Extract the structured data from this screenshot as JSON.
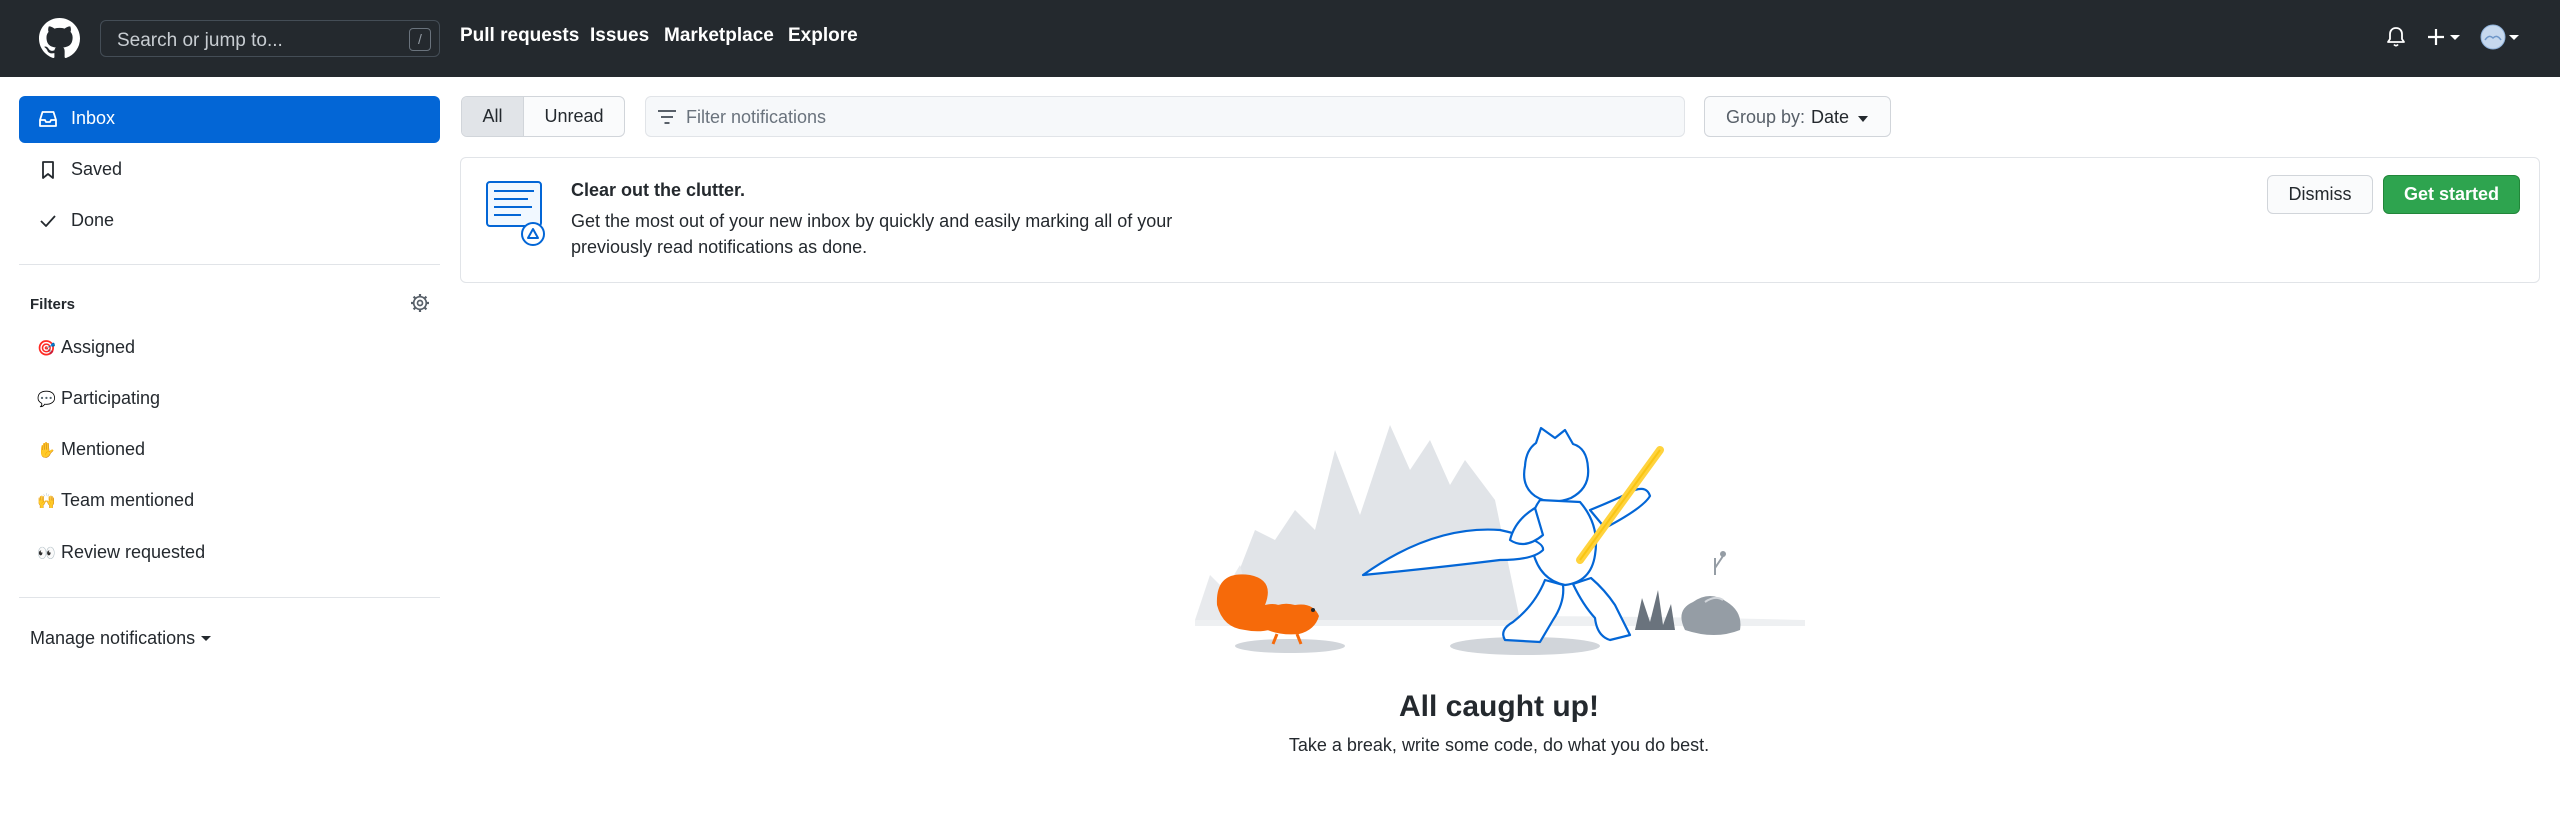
{
  "header": {
    "search_placeholder": "Search or jump to...",
    "search_shortcut": "/",
    "nav": [
      "Pull requests",
      "Issues",
      "Marketplace",
      "Explore"
    ]
  },
  "sidebar": {
    "items": [
      {
        "label": "Inbox",
        "icon": "inbox-icon",
        "active": true
      },
      {
        "label": "Saved",
        "icon": "bookmark-icon",
        "active": false
      },
      {
        "label": "Done",
        "icon": "check-icon",
        "active": false
      }
    ],
    "filters_title": "Filters",
    "filters": [
      {
        "emoji": "🎯",
        "label": "Assigned"
      },
      {
        "emoji": "💬",
        "label": "Participating"
      },
      {
        "emoji": "✋",
        "label": "Mentioned"
      },
      {
        "emoji": "🙌",
        "label": "Team mentioned"
      },
      {
        "emoji": "👀",
        "label": "Review requested"
      }
    ],
    "manage_label": "Manage notifications"
  },
  "toolbar": {
    "tab_all": "All",
    "tab_unread": "Unread",
    "filter_placeholder": "Filter notifications",
    "group_by_label": "Group by:",
    "group_by_value": "Date"
  },
  "banner": {
    "title": "Clear out the clutter.",
    "body": "Get the most out of your new inbox by quickly and easily marking all of your previously read notifications as done.",
    "dismiss": "Dismiss",
    "get_started": "Get started"
  },
  "empty_state": {
    "title": "All caught up!",
    "subtitle": "Take a break, write some code, do what you do best."
  },
  "colors": {
    "header_bg": "#24292e",
    "accent_blue": "#0366d6",
    "primary_green": "#2ea44f"
  }
}
